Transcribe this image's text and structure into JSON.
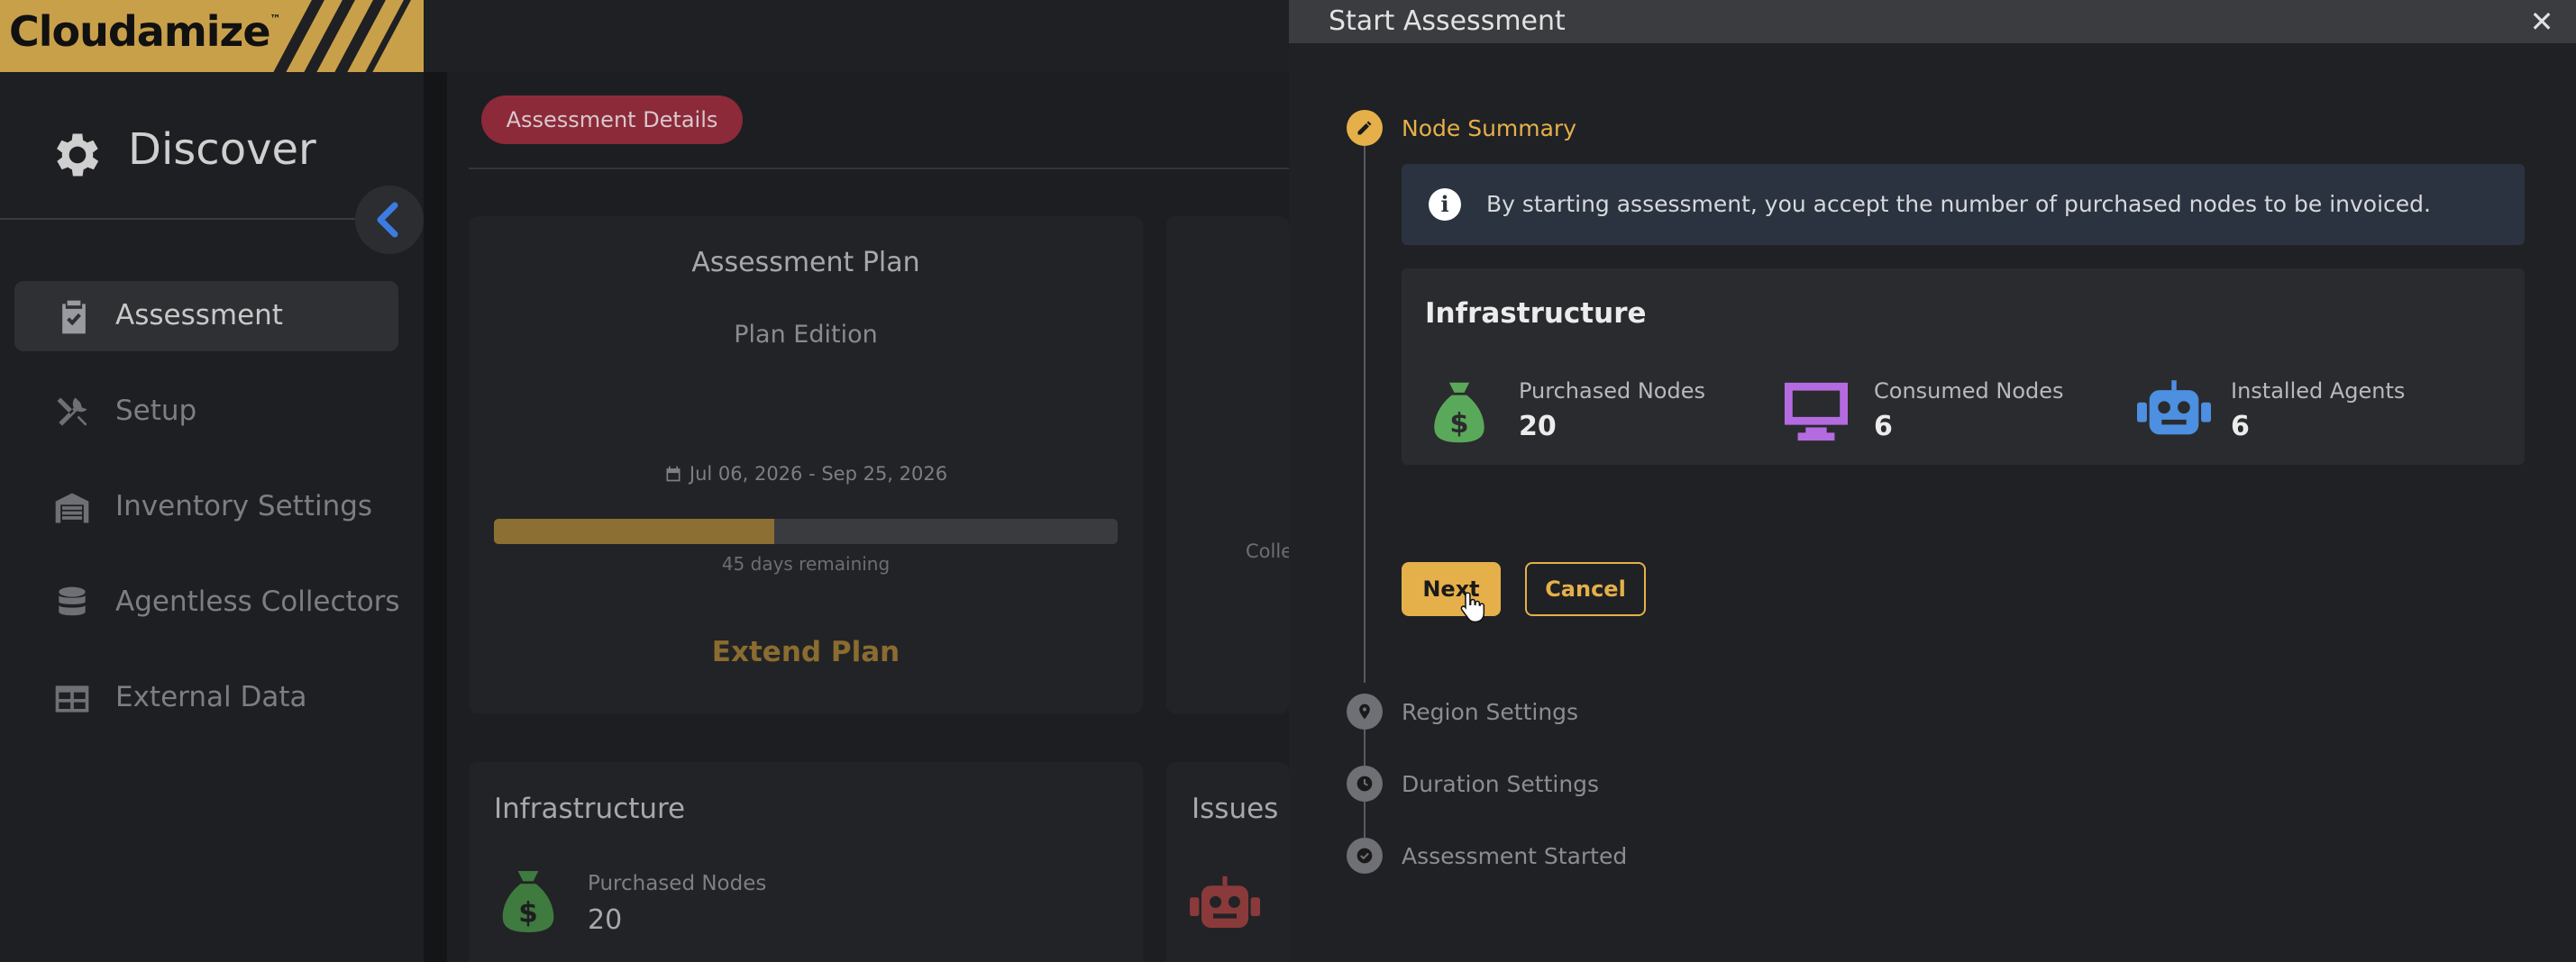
{
  "app": {
    "logo": "Cloudamize",
    "logo_tm": "™"
  },
  "sidebar": {
    "title": "Discover",
    "items": [
      {
        "label": "Assessment",
        "icon": "clipboard-check-icon",
        "active": true
      },
      {
        "label": "Setup",
        "icon": "tools-icon",
        "active": false
      },
      {
        "label": "Inventory Settings",
        "icon": "warehouse-icon",
        "active": false
      },
      {
        "label": "Agentless Collectors",
        "icon": "database-icon",
        "active": false
      },
      {
        "label": "External Data",
        "icon": "table-icon",
        "active": false
      }
    ]
  },
  "main": {
    "tab_label": "Assessment Details",
    "plan_card": {
      "title": "Assessment Plan",
      "edition": "Plan Edition",
      "dates": "Jul 06, 2026 - Sep 25, 2026",
      "progress_fraction": 0.45,
      "remaining": "45 days remaining",
      "extend_label": "Extend Plan"
    },
    "side_card_text": "Colle",
    "infra_card": {
      "title": "Infrastructure",
      "purchased_label": "Purchased Nodes",
      "purchased_value": "20"
    },
    "issues_card": {
      "title": "Issues"
    }
  },
  "modal": {
    "title": "Start Assessment",
    "close_glyph": "✕",
    "steps": [
      {
        "label": "Node Summary",
        "active": true,
        "icon": "pencil-icon"
      },
      {
        "label": "Region Settings",
        "active": false,
        "icon": "map-pin-icon"
      },
      {
        "label": "Duration Settings",
        "active": false,
        "icon": "clock-icon"
      },
      {
        "label": "Assessment Started",
        "active": false,
        "icon": "check-icon"
      }
    ],
    "info_text": "By starting assessment, you accept the number of purchased nodes to be invoiced.",
    "infra_title": "Infrastructure",
    "metrics": [
      {
        "label": "Purchased Nodes",
        "value": "20",
        "icon": "money-bag-icon",
        "color": "#5aa95a"
      },
      {
        "label": "Consumed Nodes",
        "value": "6",
        "icon": "monitor-icon",
        "color": "#b56be0"
      },
      {
        "label": "Installed Agents",
        "value": "6",
        "icon": "robot-icon",
        "color": "#4d8fe0"
      }
    ],
    "next_label": "Next",
    "cancel_label": "Cancel"
  },
  "colors": {
    "accent": "#e5b04a",
    "brand": "#c9a04a",
    "tab_pill": "#8c2a3a",
    "info_bg": "#2b3340"
  }
}
